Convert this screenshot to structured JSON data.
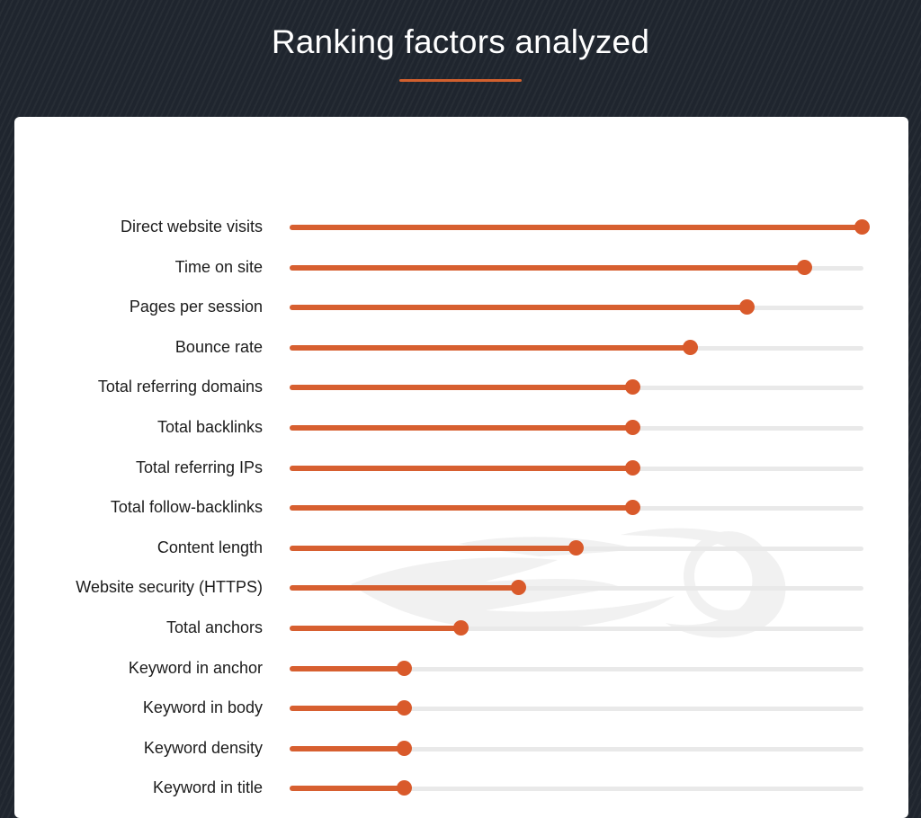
{
  "header": {
    "title": "Ranking factors analyzed"
  },
  "colors": {
    "accent": "#d75f30",
    "track": "#e9e9e9",
    "background": "#1f252e",
    "card": "#ffffff"
  },
  "chart_data": {
    "type": "bar",
    "orientation": "horizontal",
    "style": "lollipop",
    "title": "Ranking factors analyzed",
    "xlabel": "",
    "ylabel": "",
    "xlim": [
      0,
      10
    ],
    "grid": false,
    "legend": "none",
    "categories": [
      "Direct website visits",
      "Time on site",
      "Pages per session",
      "Bounce rate",
      "Total referring domains",
      "Total backlinks",
      "Total referring IPs",
      "Total follow-backlinks",
      "Content length",
      "Website security (HTTPS)",
      "Total anchors",
      "Keyword in anchor",
      "Keyword in body",
      "Keyword density",
      "Keyword in title"
    ],
    "values": [
      10,
      9,
      8,
      7,
      6,
      6,
      6,
      6,
      5,
      4,
      3,
      2,
      2,
      2,
      2
    ]
  }
}
